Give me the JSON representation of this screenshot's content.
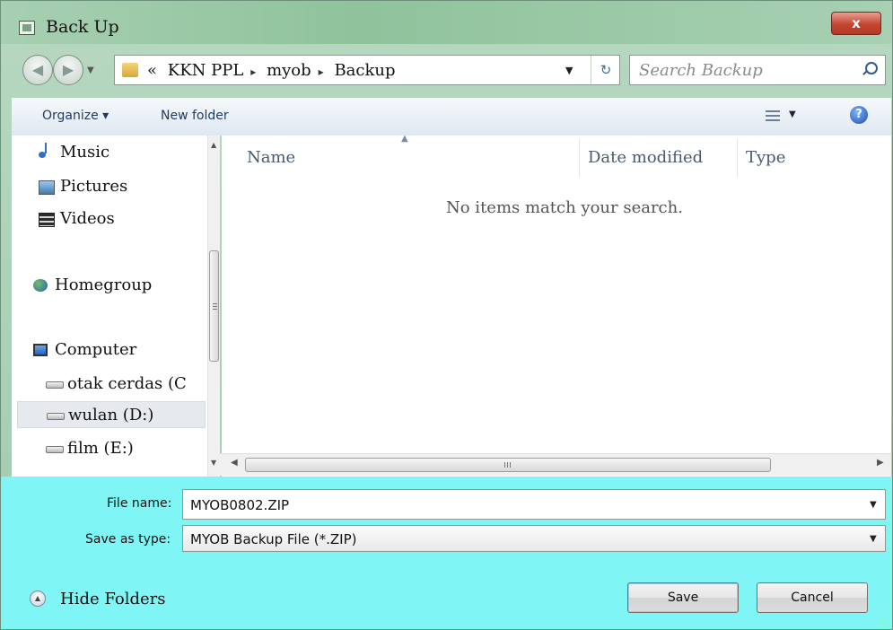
{
  "window": {
    "title": "Back Up",
    "close_symbol": "x"
  },
  "nav": {
    "back_symbol": "◀",
    "forward_symbol": "▶",
    "history_dd": "▼"
  },
  "address": {
    "overflow": "«",
    "crumbs": [
      "KKN PPL",
      "myob",
      "Backup"
    ],
    "separator": "▸",
    "dropdown": "▼",
    "refresh": "↻"
  },
  "search": {
    "placeholder": "Search Backup"
  },
  "toolbar": {
    "organize": "Organize ▾",
    "new_folder": "New folder",
    "view_dd": "▼",
    "help": "?"
  },
  "sidebar": {
    "items": [
      {
        "label": "Music",
        "icon": "music-icon"
      },
      {
        "label": "Pictures",
        "icon": "pictures-icon"
      },
      {
        "label": "Videos",
        "icon": "videos-icon"
      },
      {
        "label": "Homegroup",
        "icon": "homegroup-icon"
      },
      {
        "label": "Computer",
        "icon": "computer-icon"
      },
      {
        "label": "otak cerdas (C",
        "icon": "drive-icon"
      },
      {
        "label": "wulan (D:)",
        "icon": "drive-icon",
        "selected": true
      },
      {
        "label": "film (E:)",
        "icon": "drive-icon"
      }
    ]
  },
  "columns": {
    "name": "Name",
    "date": "Date modified",
    "type": "Type"
  },
  "empty_message": "No items match your search.",
  "form": {
    "file_name_label": "File name:",
    "file_name_value": "MYOB0802.ZIP",
    "save_type_label": "Save as type:",
    "save_type_value": "MYOB Backup File (*.ZIP)"
  },
  "buttons": {
    "hide_folders": "Hide Folders",
    "save": "Save",
    "cancel": "Cancel"
  },
  "colors": {
    "bottom_panel": "#7ff6f5",
    "title_bar": "#9fcbb0",
    "close_button": "#c4442f"
  }
}
